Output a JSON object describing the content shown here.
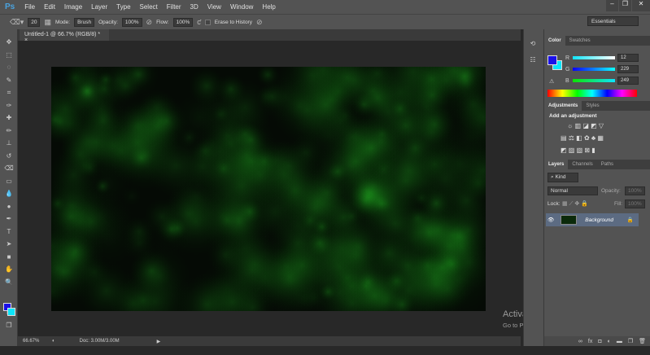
{
  "app": {
    "logo": "Ps",
    "menu": [
      "File",
      "Edit",
      "Image",
      "Layer",
      "Type",
      "Select",
      "Filter",
      "3D",
      "View",
      "Window",
      "Help"
    ],
    "window_buttons": [
      "–",
      "❐",
      "✕"
    ]
  },
  "options": {
    "brush_size": "20",
    "mode_label": "Mode:",
    "mode": "Brush",
    "opacity_label": "Opacity:",
    "opacity": "100%",
    "flow_label": "Flow:",
    "flow": "100%",
    "erase_history": "Erase to History",
    "workspace": "Essentials"
  },
  "document": {
    "tab": "Untitled-1 @ 66.7% (RGB/8) *",
    "close": "×"
  },
  "status": {
    "zoom": "66.67%",
    "doc": "Doc: 3.00M/3.00M"
  },
  "watermark": {
    "title": "Activate Windows",
    "subtitle": "Go to PC settings to activate Windows."
  },
  "color_panel": {
    "tabs": [
      "Color",
      "Swatches"
    ],
    "channels": [
      {
        "label": "R",
        "value": "12"
      },
      {
        "label": "G",
        "value": "229"
      },
      {
        "label": "B",
        "value": "249"
      }
    ],
    "foreground": "#1a10e8",
    "background": "#0ce5f9"
  },
  "adjustments": {
    "tabs": [
      "Adjustments",
      "Styles"
    ],
    "heading": "Add an adjustment"
  },
  "layers": {
    "tabs": [
      "Layers",
      "Channels",
      "Paths"
    ],
    "filter": "Kind",
    "blend": "Normal",
    "opacity_label": "Opacity:",
    "opacity": "100%",
    "lock_label": "Lock:",
    "fill_label": "Fill:",
    "fill": "100%",
    "layer_name": "Background"
  }
}
